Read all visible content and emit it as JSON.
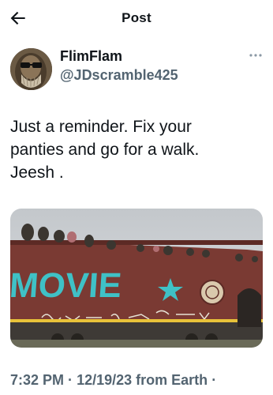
{
  "header": {
    "title": "Post",
    "back_icon": "arrow-left-icon"
  },
  "author": {
    "display_name": "FlimFlam",
    "handle": "@JDscramble425",
    "avatar_icon": "avatar-photo"
  },
  "more_icon": "more-horizontal-icon",
  "post": {
    "text": "Just a reminder. Fix your\npanties and go for a walk.\nJeesh .",
    "media": {
      "type": "photo",
      "painted_text": "MOVIE"
    }
  },
  "meta": {
    "time": "7:32 PM",
    "date": "12/19/23",
    "source": "from Earth",
    "separator": "·"
  },
  "colors": {
    "text": "#0f1419",
    "secondary": "#536471",
    "train": "#7a3a33",
    "graffiti": "#3fc1c6"
  }
}
